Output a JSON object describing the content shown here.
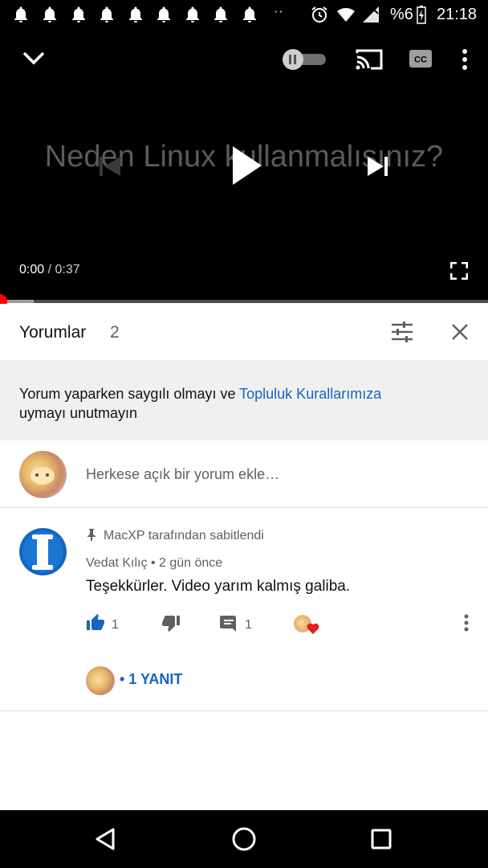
{
  "status_bar": {
    "battery": "%6",
    "clock": "21:18",
    "overflow_dots": "··"
  },
  "player": {
    "video_title_overlay": "Neden Linux kullanmalısınız?",
    "time_current": "0:00",
    "time_separator": " / ",
    "time_total": "0:37",
    "progress_fraction": 0.0
  },
  "comments": {
    "header_title": "Yorumlar",
    "header_count": "2",
    "notice_text": "Yorum yaparken saygılı olmayı ve ",
    "notice_link": "Topluluk Kurallarımıza",
    "notice_text_end": "uymayı unutmayın",
    "add_placeholder": "Herkese açık bir yorum ekle…",
    "items": [
      {
        "pinned_label": "MacXP tarafından sabitlendi",
        "author": "Vedat Kılıç",
        "separator": " • ",
        "time": "2 gün önce",
        "text": "Teşekkürler.  Video yarım kalmış galiba.",
        "like_count": "1",
        "reply_count": "1",
        "replies_link": "• 1 YANIT"
      }
    ]
  },
  "colors": {
    "accent_link": "#1565c0",
    "progress_red": "#ff0000",
    "like_blue": "#1565c0"
  }
}
